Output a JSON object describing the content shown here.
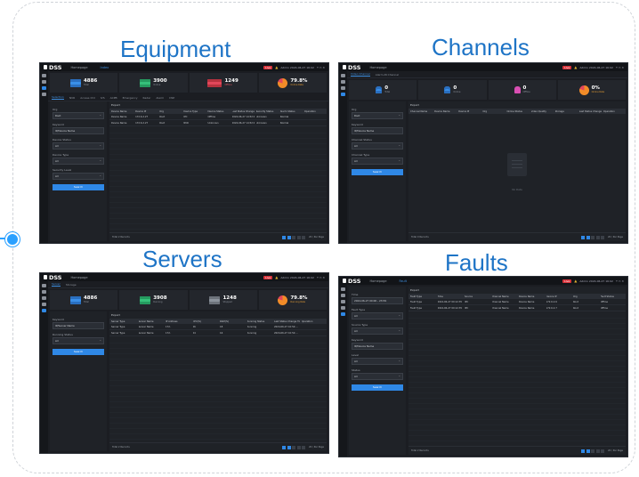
{
  "captions": {
    "equipment": "Equipment",
    "channels": "Channels",
    "servers": "Servers",
    "faults": "Faults"
  },
  "app": {
    "logo": "DSS",
    "home": "Homepage",
    "status_badge": "Live",
    "user": "Admin  2024-06-27  16:02"
  },
  "equipment": {
    "tab": "Index",
    "subtabs": [
      "Selection",
      "NVR",
      "Access Ctrl",
      "IVS",
      "ACPB",
      "Emergency",
      "Radar",
      "Alarm",
      "DSP"
    ],
    "stats": [
      {
        "value": "4886",
        "label": "Total"
      },
      {
        "value": "3900",
        "label": "Online"
      },
      {
        "value": "1249",
        "label": "Offline"
      },
      {
        "value": "79.8%",
        "label": "Online Rate"
      }
    ],
    "filter": {
      "org_label": "Org",
      "org_value": "Root",
      "keyword_label": "Keyword",
      "keyword_value": "IP/Device Name",
      "status_label": "Device Status",
      "status_value": "All",
      "type_label": "Device Type",
      "type_value": "All",
      "security_label": "Security Level",
      "security_value": "All",
      "search": "Search"
    },
    "export": "Export",
    "headers": [
      "Device Name",
      "Device IP",
      "Org",
      "Device Type",
      "Device Status",
      "Last Status Change Time",
      "Security Status",
      "Alarm Status",
      "Operation"
    ],
    "rows": [
      [
        "Device Name",
        "172.6.2.27",
        "Root",
        "IPC",
        "Offline",
        "2024-06-27 14:52:09",
        "Unknown",
        "Normal",
        ""
      ],
      [
        "Device Name",
        "172.6.2.27",
        "Root",
        "NVR",
        "Unknown",
        "2024-06-27 14:52:09",
        "Unknown",
        "Normal",
        ""
      ]
    ],
    "pager": {
      "total": "Total 2 Records",
      "size": "20 / Per Page"
    }
  },
  "channels": {
    "tab": "Video Channel",
    "subtab2": "Alarm-IN Channel",
    "stats": [
      {
        "value": "0",
        "label": "Total"
      },
      {
        "value": "0",
        "label": "Online"
      },
      {
        "value": "0",
        "label": "Offline"
      },
      {
        "value": "0%",
        "label": "Online Rate"
      }
    ],
    "filter": {
      "org_label": "Org",
      "org_value": "Root",
      "keyword_label": "Keyword",
      "keyword_value": "IP/Device Name",
      "status_label": "Channel Status",
      "status_value": "All",
      "type_label": "Channel Type",
      "type_value": "All",
      "search": "Search"
    },
    "export": "Export",
    "headers": [
      "Channel Name",
      "Device Name",
      "Device IP",
      "Org",
      "Online Status",
      "Video Quality",
      "Storage",
      "Last Status Change Time",
      "Operation"
    ],
    "nodata": "No Data",
    "pager": {
      "total": "Total 0 Records",
      "size": "20 / Per Page"
    }
  },
  "servers": {
    "tab": "Server",
    "subtab2": "Storage",
    "stats": [
      {
        "value": "4886",
        "label": "Total"
      },
      {
        "value": "3908",
        "label": "Running"
      },
      {
        "value": "1248",
        "label": "Stopped"
      },
      {
        "value": "79.8%",
        "label": "Running Rate"
      }
    ],
    "filter": {
      "keyword_label": "Keyword",
      "keyword_value": "IP/Server Name",
      "status_label": "Running Status",
      "status_value": "All",
      "search": "Search"
    },
    "export": "Export",
    "headers": [
      "Server Type",
      "Server Name",
      "IP Address",
      "CPU(%)",
      "RAM(%)",
      "Running Status",
      "Last Status Change Time",
      "Operation"
    ],
    "rows": [
      [
        "Server Type",
        "Server Name",
        "172.",
        "26",
        "18",
        "Running",
        "2024-06-27 10:52:...",
        ""
      ],
      [
        "Server Type",
        "Server Name",
        "172.",
        "24",
        "16",
        "Running",
        "2024-06-27 10:52:...",
        ""
      ]
    ],
    "pager": {
      "total": "Total 2 Records",
      "size": "20 / Per Page"
    }
  },
  "faults": {
    "tab": "Fault",
    "filter": {
      "time_label": "Time",
      "time_value": "2024-06-27 00:00 - 23:59",
      "fault_label": "Fault Type",
      "fault_value": "All",
      "source_label": "Source Type",
      "source_value": "All",
      "keyword_label": "Keyword",
      "keyword_value": "IP/Device Name",
      "level_label": "Level",
      "level_value": "All",
      "status_label": "Status",
      "status_value": "All",
      "search": "Search"
    },
    "export": "Export",
    "headers": [
      "Fault Type",
      "Time",
      "Source",
      "Channel Name",
      "Device Name",
      "Device IP",
      "Org",
      "Fault Status"
    ],
    "rows": [
      [
        "Fault Type",
        "2024-06-27 09:12:35",
        "IPC",
        "Channel Name",
        "Device Name",
        "172.6.2.6",
        "Root",
        "Offline"
      ],
      [
        "Fault Type",
        "2024-06-27 09:12:35",
        "IPC",
        "Channel Name",
        "Device Name",
        "172.6.2.7",
        "Root",
        "Offline"
      ]
    ],
    "pager": {
      "total": "Total 2 Records",
      "size": "20 / Per Page"
    }
  }
}
